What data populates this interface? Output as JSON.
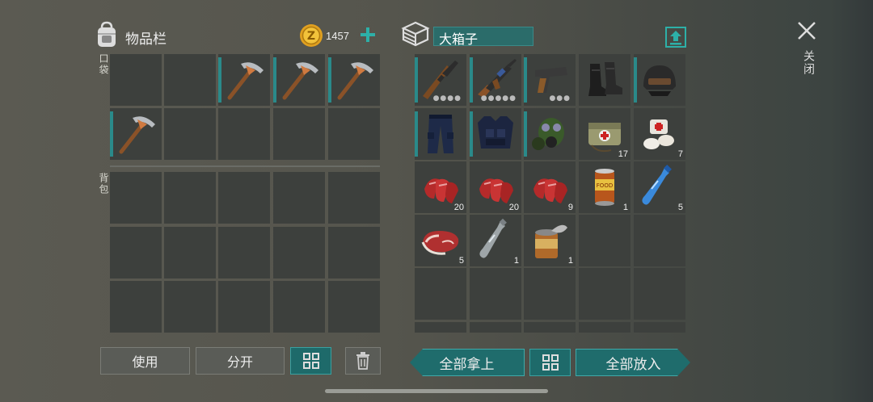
{
  "inventory": {
    "title": "物品栏",
    "coins": "1457",
    "pocket_label": "口袋",
    "backpack_label": "背包",
    "pocket_items": [
      "pickaxe",
      "pickaxe",
      "pickaxe",
      "pickaxe"
    ]
  },
  "container": {
    "title": "大箱子",
    "items": [
      {
        "name": "rifle-sniper",
        "qty": ""
      },
      {
        "name": "assault-rifle",
        "qty": ""
      },
      {
        "name": "pistol",
        "qty": ""
      },
      {
        "name": "combat-boots",
        "qty": ""
      },
      {
        "name": "tactical-helmet",
        "qty": ""
      },
      {
        "name": "tactical-pants",
        "qty": ""
      },
      {
        "name": "tactical-vest",
        "qty": ""
      },
      {
        "name": "gas-mask",
        "qty": ""
      },
      {
        "name": "medkit-bag",
        "qty": "17"
      },
      {
        "name": "bandages",
        "qty": "7"
      },
      {
        "name": "raw-meat-strips",
        "qty": "20"
      },
      {
        "name": "raw-meat-strips",
        "qty": "20"
      },
      {
        "name": "raw-meat-strips",
        "qty": "9"
      },
      {
        "name": "canned-food",
        "qty": "1"
      },
      {
        "name": "water-bottle",
        "qty": "5"
      },
      {
        "name": "steak",
        "qty": "5"
      },
      {
        "name": "empty-bottle",
        "qty": "1"
      },
      {
        "name": "open-can",
        "qty": "1"
      }
    ]
  },
  "buttons": {
    "use": "使用",
    "split": "分开",
    "take_all": "全部拿上",
    "put_all": "全部放入",
    "close": "关闭"
  },
  "colors": {
    "accent": "#2a8a8a",
    "button_teal": "#1f6c6c"
  }
}
